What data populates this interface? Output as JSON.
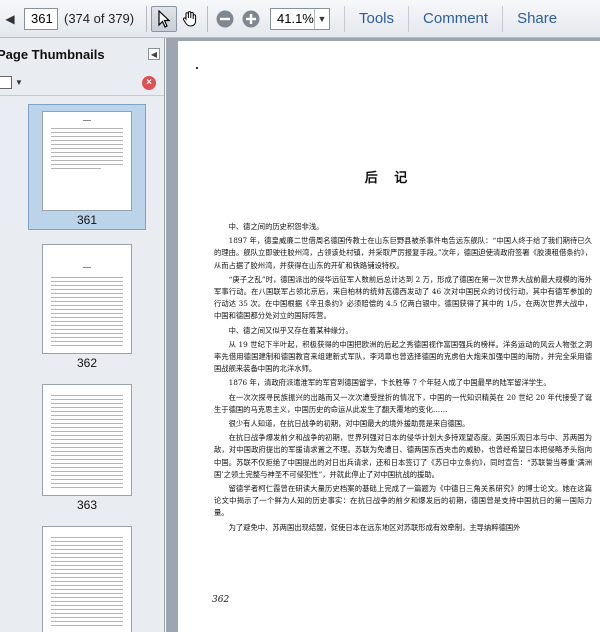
{
  "toolbar": {
    "page_value": "361",
    "page_count": "(374 of 379)",
    "zoom_value": "41.1%",
    "tools_label": "Tools",
    "comment_label": "Comment",
    "share_label": "Share"
  },
  "panel": {
    "title": "Page Thumbnails",
    "thumbnails": [
      {
        "number": "361"
      },
      {
        "number": "362"
      },
      {
        "number": "363"
      }
    ]
  },
  "document": {
    "heading": "后 记",
    "page_number": "362",
    "paragraphs": [
      "中、德之间的历史积怨非浅。",
      "1897 年，德皇威廉二世借周名德国传教士在山东巨野县被杀事件电告远东舰队：“中国人终于给了我们期待已久的理由。舰队立即驶往胶州湾，占领该处村镇，并采取严厉报复手段。”次年，德国迫使清政府签署《胶澳租借条约》，从而占据了胶州湾，并获得在山东的开矿和铁路铺设特权。",
      "“庚子之乱”时，德国派出的侵华远征军人数前后总计达到 2 万，形成了德国在第一次世界大战前最大规模的海外军事行动。在八国联军占领北京后，来自柏林的统帅瓦德西发动了 46 次对中国民众的讨伐行动，其中有德军参加的行动达 35 次。在中国根据《辛丑条约》必须赔偿的 4.5 亿两白银中，德国获得了其中的 1/5，在两次世界大战中，中国和德国都分处对立的国际阵营。",
      "中、德之间又似乎又存在着某种缘分。",
      "从 19 世纪下半叶起，积极获得的中国把欧洲的后起之秀德国视作富国强兵的榜样。洋务运动的风云人物张之洞率先借用德国建制和德国教官来组建新式军队，李鸿章也曾选择德国的克虏伯大炮来加强中国的海防，并完全采用德国战舰来装备中国的北洋水师。",
      "1876 年，清政府派遣淮军的军官到德国留学，卞长胜等 7 个年轻人成了中国最早的陆军留洋学生。",
      "在一次次探寻民族振兴的出路而又一次次遭受挫折的情况下，中国的一代知识精英在 20 世纪 20 年代接受了诞生于德国的马克思主义，中国历史的命运从此发生了翻天覆地的变化……",
      "很少有人知道，在抗日战争的初期，对中国最大的境外援助竟是来自德国。",
      "在抗日战争爆发前夕和战争的初期，世界列强对日本的侵华计划大多持观望态度。英国乐观日本与中、苏两国为敌，对中国政府提出的军援请求置之不理。苏联为免遭日、德两国东西夹击的威胁，也曾经希望日本把侵略矛头指向中国。苏联不仅拒绝了中国提出的对日出兵请求，还和日本签订了《苏日中立条约》，同时宣告：“苏联誓当尊重‘满洲国’之领土完整与神圣不可侵犯性”，并就此停止了对中国抗战的援助。",
      "留德学者柯仁霞曾在研读大量历史档案的基础上完成了一篇题为《中德日三角关系研究》的博士论文。她在这篇论文中揭示了一个鲜为人知的历史事实：在抗日战争的前夕和爆发后的初期，德国曾是支持中国抗日的第一国际力量。",
      "为了避免中、苏两国出现结盟，促使日本在远东地区对苏联形成有效牵制，主导纳粹德国外"
    ]
  }
}
